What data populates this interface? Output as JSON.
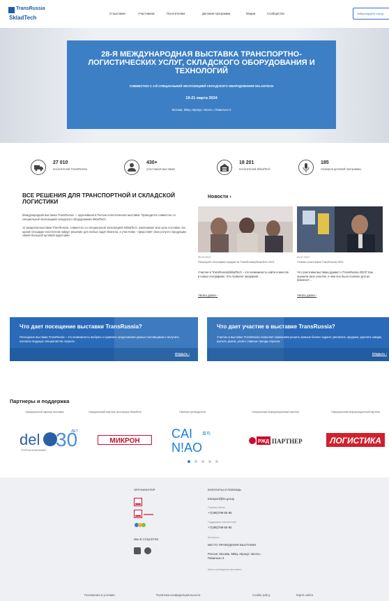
{
  "header": {
    "logo": {
      "line1": "TransRussia",
      "line2": "SkladTech"
    },
    "nav": [
      "О выставке",
      "Участникам",
      "Посетителям",
      "Деловая программа",
      "Медиа",
      "Сообщество"
    ],
    "cta_label": "Забронируйте стенд"
  },
  "hero": {
    "title": "28-я Международная выставка транспортно-логистических услуг, складского оборудования и технологий",
    "subtitle": "СОВМЕСТНО С 3-Й СПЕЦИАЛЬНОЙ ЭКСПОЗИЦИЕЙ СКЛАДСКОГО ОБОРУДОВАНИЯ SKLADTECH",
    "dates": "19-21 марта 2024",
    "venue": "Москва, МВЦ «Крокус Экспо», Павильон 3"
  },
  "stats": [
    {
      "icon": "truck-icon",
      "number": "27 010",
      "label": "посетителей TransRussia"
    },
    {
      "icon": "person-icon",
      "number": "430+",
      "label": "участников выставки"
    },
    {
      "icon": "warehouse-icon",
      "number": "18 201",
      "label": "посетителей SkladTech"
    },
    {
      "icon": "microphone-icon",
      "number": "185",
      "label": "спикеров деловой программы"
    }
  ],
  "solutions": {
    "title": "Все решения для транспортной и складской логистики",
    "paragraphs": [
      "Международная выставка TransRussia — крупнейшая в России логистическая выставка. Проводится совместно со специальной экспозицией складского оборудования SkladTech.",
      "12 разделов выставки TransRussia, совместно со специальной экспозицией SkladTech, охватывают всю цепь поставок. На одной площадке посетители найдут решение для любых задач бизнеса, а участники - представят свои услуги и продукцию самой большой целевой аудитории."
    ]
  },
  "news": {
    "title": "Новости",
    "items": [
      {
        "date": "06.03.2023",
        "caption": "Расширите географию продаж на TransRussia|SkladTech 2024",
        "text": "Участие в TransRussia|SkladTech – это возможность найти клиентов в новых географиях. Это позволит предприят...",
        "more": "Читать далее"
      },
      {
        "date": "20.07.2023",
        "caption": "Отзывы участников TransRussia 2023",
        "text": "Что участники выставки думают о TransRussia 2023? Как оценили свое участие, и чем оно было полезно для их бизнеса?...",
        "more": "Читать далее"
      }
    ]
  },
  "banners": [
    {
      "title": "Что дает посещение выставки TransRussia?",
      "text": "Посещение выставки TransRussia – это возможность выбрать и сравнить предложения разных поставщиков и получить контакты ведущих специалистов отрасли",
      "button": "Открыть"
    },
    {
      "title": "Что дает участие в выставке TransRussia?",
      "text": "Участие в выставке TransRussia позволяет компаниям решить важные бизнес-задачи: увеличить продажи, укрепить имидж, изучить рынок, узнать главные тренды отрасли",
      "button": "Открыть"
    }
  ],
  "partners": {
    "title": "Партнеры и поддержка",
    "items": [
      {
        "label": "Официальный партнер выставки",
        "logo": "delo",
        "logo_text": "30",
        "logo_sub": "ГРУППА КОМПАНИЙ",
        "logo_badge": "ЛЕТ"
      },
      {
        "label": "Официальный партнер экспозиции SkladTech",
        "logo": "mikron",
        "logo_text": "МИКРОН"
      },
      {
        "label": "Партнер путеводителя",
        "logo": "cainiao",
        "logo_text": "CAI NIAO",
        "logo_sub": "菜鸟"
      },
      {
        "label": "Генеральный информационный партнер",
        "logo": "rzd",
        "logo_text": "ПАРТНЕР",
        "logo_sub": "РЖД"
      },
      {
        "label": "Официальный информационный партнер",
        "logo": "logistika",
        "logo_text": "ЛОГИСТИКА"
      }
    ],
    "dots": 5
  },
  "footer": {
    "organizer_head": "Организатор",
    "organizer_logos": [
      "ite",
      "ite moscow",
      "wtg"
    ],
    "social_head": "Мы в соцсетях",
    "contacts_head": "Контакты и помощь",
    "email": "transport@ite.group",
    "hotline_label": "Горячая линия",
    "hotline": "+7(495)799-55-85",
    "support_label": "Поддержка посетителей",
    "support": "+7(495)799-55-85",
    "contacts_link": "Контакты",
    "venue_head": "Место проведения выставки",
    "venue_address": "Россия, Москва, МВЦ «Крокус Экспо», Павильон 3",
    "venue_link": "Место проведения выставки",
    "links": [
      "Положения и условия",
      "Политика конфиденциальности",
      "Cookie policy",
      "Карта сайта"
    ]
  }
}
